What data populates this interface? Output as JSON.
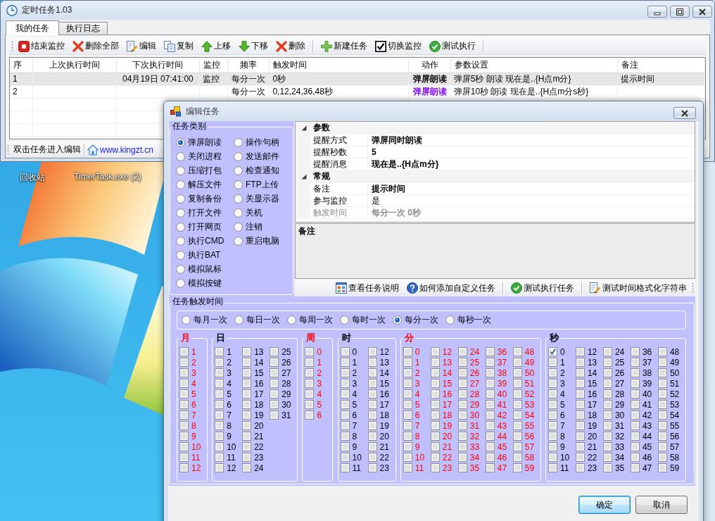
{
  "main_window": {
    "title": "定时任务1.03"
  },
  "tabs": [
    {
      "label": "我的任务",
      "selected": true
    },
    {
      "label": "执行日志",
      "selected": false
    }
  ],
  "toolbar": {
    "groups": [
      [
        {
          "label": "结束监控",
          "kind": "stop"
        },
        {
          "label": "删除全部",
          "kind": "delete"
        },
        {
          "label": "编辑",
          "kind": "edit"
        },
        {
          "label": "复制",
          "kind": "copy"
        },
        {
          "label": "上移",
          "kind": "up"
        },
        {
          "label": "下移",
          "kind": "down"
        },
        {
          "label": "删除",
          "kind": "delete"
        }
      ],
      [
        {
          "label": "新建任务",
          "kind": "new"
        },
        {
          "label": "切换监控",
          "kind": "toggle"
        },
        {
          "label": "测试执行",
          "kind": "run"
        }
      ]
    ]
  },
  "task_table": {
    "columns": [
      "序",
      "上次执行时间",
      "下次执行时间",
      "监控",
      "频率",
      "触发时间",
      "动作",
      "参数设置",
      "备注"
    ],
    "rows": [
      {
        "selected": true,
        "no": "1",
        "next_run": "04月19日 07:41:00",
        "monitor": "监控",
        "frequency": "每分一次",
        "trigger": "0秒",
        "action": {
          "label": "弹屏朗读",
          "color": "#000000"
        },
        "params": "弹屏5秒 朗读 现在是..{H点m分}",
        "note": "提示时间"
      },
      {
        "selected": false,
        "no": "2",
        "frequency": "每分一次",
        "trigger": "0,12,24,36,48秒",
        "action": {
          "label": "弹屏朗读",
          "color": "#8000ff"
        },
        "params": "弹屏10秒 朗读 现在是..{H点m分s秒}"
      }
    ]
  },
  "status_bar": {
    "hint": "双击任务进入编辑",
    "link": "www.kingzt.cn"
  },
  "desktop_icons": [
    {
      "label": "回收站"
    },
    {
      "label": "TimerTask.exe (2)"
    }
  ],
  "edit_dialog": {
    "title": "编辑任务",
    "task_types": {
      "title": "任务类别",
      "options": [
        {
          "label": "弹屏朗读",
          "selected": true
        },
        {
          "label": "关闭进程",
          "selected": false
        },
        {
          "label": "压缩打包",
          "selected": false
        },
        {
          "label": "解压文件",
          "selected": false
        },
        {
          "label": "复制备份",
          "selected": false
        },
        {
          "label": "打开文件",
          "selected": false
        },
        {
          "label": "打开网页",
          "selected": false
        },
        {
          "label": "执行CMD",
          "selected": false
        },
        {
          "label": "执行BAT",
          "selected": false
        },
        {
          "label": "模拟鼠标",
          "selected": false
        },
        {
          "label": "模拟按键",
          "selected": false
        },
        {
          "label": "操作句柄",
          "selected": false
        },
        {
          "label": "发送邮件",
          "selected": false
        },
        {
          "label": "检查通知",
          "selected": false
        },
        {
          "label": "FTP上传",
          "selected": false
        },
        {
          "label": "关显示器",
          "selected": false
        },
        {
          "label": "关机",
          "selected": false
        },
        {
          "label": "注销",
          "selected": false
        },
        {
          "label": "重启电脑",
          "selected": false
        }
      ]
    },
    "properties": {
      "sections": [
        {
          "title": "参数",
          "expanded": true,
          "rows": [
            {
              "name": "提醒方式",
              "value": "弹屏同时朗读",
              "modified": true,
              "disabled": false
            },
            {
              "name": "提醒秒数",
              "value": "5",
              "modified": true,
              "disabled": false
            },
            {
              "name": "提醒消息",
              "value": "现在是..{H点m分}",
              "modified": true,
              "disabled": false
            }
          ]
        },
        {
          "title": "常规",
          "expanded": true,
          "rows": [
            {
              "name": "备注",
              "value": "提示时间",
              "modified": true,
              "disabled": false
            },
            {
              "name": "参与监控",
              "value": "是",
              "modified": false,
              "disabled": false
            },
            {
              "name": "触发时间",
              "value": "每分一次 0秒",
              "modified": true,
              "disabled": true
            }
          ]
        }
      ]
    },
    "description": {
      "title": "备注"
    },
    "help_toolbar": {
      "groups": [
        [
          {
            "label": "查看任务说明",
            "kind": "info"
          },
          {
            "label": "如何添加自定义任务",
            "kind": "help"
          }
        ],
        [
          {
            "label": "测试执行任务",
            "kind": "run"
          }
        ],
        [
          {
            "label": "测试时间格式化字符串",
            "kind": "format"
          }
        ]
      ]
    },
    "trigger": {
      "title": "任务触发时间",
      "frequencies": [
        {
          "label": "每月一次",
          "selected": false
        },
        {
          "label": "每日一次",
          "selected": false
        },
        {
          "label": "每周一次",
          "selected": false
        },
        {
          "label": "每时一次",
          "selected": false
        },
        {
          "label": "每分一次",
          "selected": true
        },
        {
          "label": "每秒一次",
          "selected": false
        }
      ],
      "groups": [
        {
          "title": "月",
          "color": "#ff0000",
          "options": [
            {
              "label": "1",
              "checked": false
            },
            {
              "label": "2",
              "checked": false
            },
            {
              "label": "3",
              "checked": false
            },
            {
              "label": "4",
              "checked": false
            },
            {
              "label": "5",
              "checked": false
            },
            {
              "label": "6",
              "checked": false
            },
            {
              "label": "7",
              "checked": false
            },
            {
              "label": "8",
              "checked": false
            },
            {
              "label": "9",
              "checked": false
            },
            {
              "label": "10",
              "checked": false
            },
            {
              "label": "11",
              "checked": false
            },
            {
              "label": "12",
              "checked": false
            }
          ]
        },
        {
          "title": "日",
          "color": "#000000",
          "options": [
            {
              "label": "1",
              "checked": false
            },
            {
              "label": "2",
              "checked": false
            },
            {
              "label": "3",
              "checked": false
            },
            {
              "label": "4",
              "checked": false
            },
            {
              "label": "5",
              "checked": false
            },
            {
              "label": "6",
              "checked": false
            },
            {
              "label": "7",
              "checked": false
            },
            {
              "label": "8",
              "checked": false
            },
            {
              "label": "9",
              "checked": false
            },
            {
              "label": "10",
              "checked": false
            },
            {
              "label": "11",
              "checked": false
            },
            {
              "label": "12",
              "checked": false
            },
            {
              "label": "13",
              "checked": false
            },
            {
              "label": "14",
              "checked": false
            },
            {
              "label": "15",
              "checked": false
            },
            {
              "label": "16",
              "checked": false
            },
            {
              "label": "17",
              "checked": false
            },
            {
              "label": "18",
              "checked": false
            },
            {
              "label": "19",
              "checked": false
            },
            {
              "label": "20",
              "checked": false
            },
            {
              "label": "21",
              "checked": false
            },
            {
              "label": "22",
              "checked": false
            },
            {
              "label": "23",
              "checked": false
            },
            {
              "label": "24",
              "checked": false
            },
            {
              "label": "25",
              "checked": false
            },
            {
              "label": "26",
              "checked": false
            },
            {
              "label": "27",
              "checked": false
            },
            {
              "label": "28",
              "checked": false
            },
            {
              "label": "29",
              "checked": false
            },
            {
              "label": "30",
              "checked": false
            },
            {
              "label": "31",
              "checked": false
            }
          ]
        },
        {
          "title": "周",
          "color": "#ff0000",
          "options": [
            {
              "label": "0",
              "checked": false
            },
            {
              "label": "1",
              "checked": false
            },
            {
              "label": "2",
              "checked": false
            },
            {
              "label": "3",
              "checked": false
            },
            {
              "label": "4",
              "checked": false
            },
            {
              "label": "5",
              "checked": false
            },
            {
              "label": "6",
              "checked": false
            }
          ]
        },
        {
          "title": "时",
          "color": "#000000",
          "options": [
            {
              "label": "0",
              "checked": false
            },
            {
              "label": "1",
              "checked": false
            },
            {
              "label": "2",
              "checked": false
            },
            {
              "label": "3",
              "checked": false
            },
            {
              "label": "4",
              "checked": false
            },
            {
              "label": "5",
              "checked": false
            },
            {
              "label": "6",
              "checked": false
            },
            {
              "label": "7",
              "checked": false
            },
            {
              "label": "8",
              "checked": false
            },
            {
              "label": "9",
              "checked": false
            },
            {
              "label": "10",
              "checked": false
            },
            {
              "label": "11",
              "checked": false
            },
            {
              "label": "12",
              "checked": false
            },
            {
              "label": "13",
              "checked": false
            },
            {
              "label": "14",
              "checked": false
            },
            {
              "label": "15",
              "checked": false
            },
            {
              "label": "16",
              "checked": false
            },
            {
              "label": "17",
              "checked": false
            },
            {
              "label": "18",
              "checked": false
            },
            {
              "label": "19",
              "checked": false
            },
            {
              "label": "20",
              "checked": false
            },
            {
              "label": "21",
              "checked": false
            },
            {
              "label": "22",
              "checked": false
            },
            {
              "label": "23",
              "checked": false
            }
          ]
        },
        {
          "title": "分",
          "color": "#ff0000",
          "options": [
            {
              "label": "0",
              "checked": false
            },
            {
              "label": "1",
              "checked": false
            },
            {
              "label": "2",
              "checked": false
            },
            {
              "label": "3",
              "checked": false
            },
            {
              "label": "4",
              "checked": false
            },
            {
              "label": "5",
              "checked": false
            },
            {
              "label": "6",
              "checked": false
            },
            {
              "label": "7",
              "checked": false
            },
            {
              "label": "8",
              "checked": false
            },
            {
              "label": "9",
              "checked": false
            },
            {
              "label": "10",
              "checked": false
            },
            {
              "label": "11",
              "checked": false
            },
            {
              "label": "12",
              "checked": false
            },
            {
              "label": "13",
              "checked": false
            },
            {
              "label": "14",
              "checked": false
            },
            {
              "label": "15",
              "checked": false
            },
            {
              "label": "16",
              "checked": false
            },
            {
              "label": "17",
              "checked": false
            },
            {
              "label": "18",
              "checked": false
            },
            {
              "label": "19",
              "checked": false
            },
            {
              "label": "20",
              "checked": false
            },
            {
              "label": "21",
              "checked": false
            },
            {
              "label": "22",
              "checked": false
            },
            {
              "label": "23",
              "checked": false
            },
            {
              "label": "24",
              "checked": false
            },
            {
              "label": "25",
              "checked": false
            },
            {
              "label": "26",
              "checked": false
            },
            {
              "label": "27",
              "checked": false
            },
            {
              "label": "28",
              "checked": false
            },
            {
              "label": "29",
              "checked": false
            },
            {
              "label": "30",
              "checked": false
            },
            {
              "label": "31",
              "checked": false
            },
            {
              "label": "32",
              "checked": false
            },
            {
              "label": "33",
              "checked": false
            },
            {
              "label": "34",
              "checked": false
            },
            {
              "label": "35",
              "checked": false
            },
            {
              "label": "36",
              "checked": false
            },
            {
              "label": "37",
              "checked": false
            },
            {
              "label": "38",
              "checked": false
            },
            {
              "label": "39",
              "checked": false
            },
            {
              "label": "40",
              "checked": false
            },
            {
              "label": "41",
              "checked": false
            },
            {
              "label": "42",
              "checked": false
            },
            {
              "label": "43",
              "checked": false
            },
            {
              "label": "44",
              "checked": false
            },
            {
              "label": "45",
              "checked": false
            },
            {
              "label": "46",
              "checked": false
            },
            {
              "label": "47",
              "checked": false
            },
            {
              "label": "48",
              "checked": false
            },
            {
              "label": "49",
              "checked": false
            },
            {
              "label": "50",
              "checked": false
            },
            {
              "label": "51",
              "checked": false
            },
            {
              "label": "52",
              "checked": false
            },
            {
              "label": "53",
              "checked": false
            },
            {
              "label": "54",
              "checked": false
            },
            {
              "label": "55",
              "checked": false
            },
            {
              "label": "56",
              "checked": false
            },
            {
              "label": "57",
              "checked": false
            },
            {
              "label": "58",
              "checked": false
            },
            {
              "label": "59",
              "checked": false
            }
          ]
        },
        {
          "title": "秒",
          "color": "#000000",
          "options": [
            {
              "label": "0",
              "checked": true
            },
            {
              "label": "1",
              "checked": false
            },
            {
              "label": "2",
              "checked": false
            },
            {
              "label": "3",
              "checked": false
            },
            {
              "label": "4",
              "checked": false
            },
            {
              "label": "5",
              "checked": false
            },
            {
              "label": "6",
              "checked": false
            },
            {
              "label": "7",
              "checked": false
            },
            {
              "label": "8",
              "checked": false
            },
            {
              "label": "9",
              "checked": false
            },
            {
              "label": "10",
              "checked": false
            },
            {
              "label": "11",
              "checked": false
            },
            {
              "label": "12",
              "checked": false
            },
            {
              "label": "13",
              "checked": false
            },
            {
              "label": "14",
              "checked": false
            },
            {
              "label": "15",
              "checked": false
            },
            {
              "label": "16",
              "checked": false
            },
            {
              "label": "17",
              "checked": false
            },
            {
              "label": "18",
              "checked": false
            },
            {
              "label": "19",
              "checked": false
            },
            {
              "label": "20",
              "checked": false
            },
            {
              "label": "21",
              "checked": false
            },
            {
              "label": "22",
              "checked": false
            },
            {
              "label": "23",
              "checked": false
            },
            {
              "label": "24",
              "checked": false
            },
            {
              "label": "25",
              "checked": false
            },
            {
              "label": "26",
              "checked": false
            },
            {
              "label": "27",
              "checked": false
            },
            {
              "label": "28",
              "checked": false
            },
            {
              "label": "29",
              "checked": false
            },
            {
              "label": "30",
              "checked": false
            },
            {
              "label": "31",
              "checked": false
            },
            {
              "label": "32",
              "checked": false
            },
            {
              "label": "33",
              "checked": false
            },
            {
              "label": "34",
              "checked": false
            },
            {
              "label": "35",
              "checked": false
            },
            {
              "label": "36",
              "checked": false
            },
            {
              "label": "37",
              "checked": false
            },
            {
              "label": "38",
              "checked": false
            },
            {
              "label": "39",
              "checked": false
            },
            {
              "label": "40",
              "checked": false
            },
            {
              "label": "41",
              "checked": false
            },
            {
              "label": "42",
              "checked": false
            },
            {
              "label": "43",
              "checked": false
            },
            {
              "label": "44",
              "checked": false
            },
            {
              "label": "45",
              "checked": false
            },
            {
              "label": "46",
              "checked": false
            },
            {
              "label": "47",
              "checked": false
            },
            {
              "label": "48",
              "checked": false
            },
            {
              "label": "49",
              "checked": false
            },
            {
              "label": "50",
              "checked": false
            },
            {
              "label": "51",
              "checked": false
            },
            {
              "label": "52",
              "checked": false
            },
            {
              "label": "53",
              "checked": false
            },
            {
              "label": "54",
              "checked": false
            },
            {
              "label": "55",
              "checked": false
            },
            {
              "label": "56",
              "checked": false
            },
            {
              "label": "57",
              "checked": false
            },
            {
              "label": "58",
              "checked": false
            },
            {
              "label": "59",
              "checked": false
            }
          ]
        }
      ]
    },
    "buttons": [
      {
        "label": "确定",
        "focused": true
      },
      {
        "label": "取消",
        "focused": false
      }
    ]
  }
}
